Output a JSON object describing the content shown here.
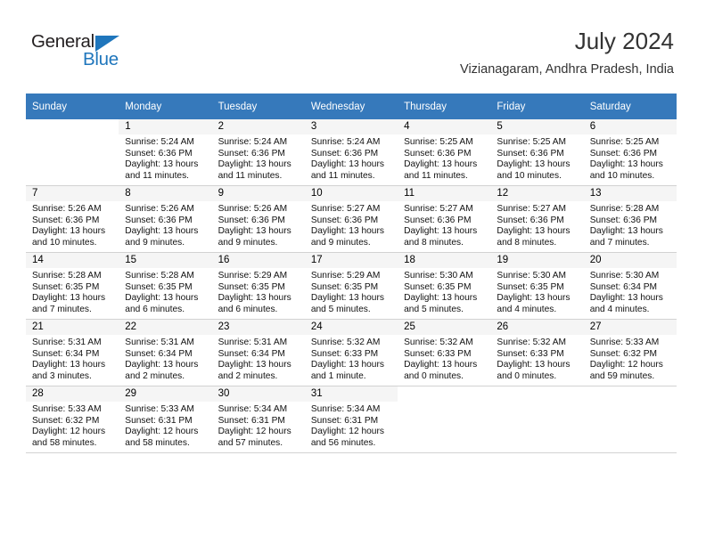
{
  "brand": {
    "name_part1": "General",
    "name_part2": "Blue",
    "colors": {
      "blue": "#1f76bc",
      "dark": "#231f20"
    }
  },
  "header": {
    "title": "July 2024",
    "subtitle": "Vizianagaram, Andhra Pradesh, India"
  },
  "calendar": {
    "header_bg": "#3679bb",
    "weekday_headers": [
      "Sunday",
      "Monday",
      "Tuesday",
      "Wednesday",
      "Thursday",
      "Friday",
      "Saturday"
    ],
    "labels": {
      "sunrise_prefix": "Sunrise:",
      "sunset_prefix": "Sunset:",
      "daylight_prefix": "Daylight:"
    },
    "weeks": [
      [
        {
          "day": "",
          "sunrise": "",
          "sunset": "",
          "daylight_line1": "",
          "daylight_line2": ""
        },
        {
          "day": "1",
          "sunrise": "Sunrise: 5:24 AM",
          "sunset": "Sunset: 6:36 PM",
          "daylight_line1": "Daylight: 13 hours",
          "daylight_line2": "and 11 minutes."
        },
        {
          "day": "2",
          "sunrise": "Sunrise: 5:24 AM",
          "sunset": "Sunset: 6:36 PM",
          "daylight_line1": "Daylight: 13 hours",
          "daylight_line2": "and 11 minutes."
        },
        {
          "day": "3",
          "sunrise": "Sunrise: 5:24 AM",
          "sunset": "Sunset: 6:36 PM",
          "daylight_line1": "Daylight: 13 hours",
          "daylight_line2": "and 11 minutes."
        },
        {
          "day": "4",
          "sunrise": "Sunrise: 5:25 AM",
          "sunset": "Sunset: 6:36 PM",
          "daylight_line1": "Daylight: 13 hours",
          "daylight_line2": "and 11 minutes."
        },
        {
          "day": "5",
          "sunrise": "Sunrise: 5:25 AM",
          "sunset": "Sunset: 6:36 PM",
          "daylight_line1": "Daylight: 13 hours",
          "daylight_line2": "and 10 minutes."
        },
        {
          "day": "6",
          "sunrise": "Sunrise: 5:25 AM",
          "sunset": "Sunset: 6:36 PM",
          "daylight_line1": "Daylight: 13 hours",
          "daylight_line2": "and 10 minutes."
        }
      ],
      [
        {
          "day": "7",
          "sunrise": "Sunrise: 5:26 AM",
          "sunset": "Sunset: 6:36 PM",
          "daylight_line1": "Daylight: 13 hours",
          "daylight_line2": "and 10 minutes."
        },
        {
          "day": "8",
          "sunrise": "Sunrise: 5:26 AM",
          "sunset": "Sunset: 6:36 PM",
          "daylight_line1": "Daylight: 13 hours",
          "daylight_line2": "and 9 minutes."
        },
        {
          "day": "9",
          "sunrise": "Sunrise: 5:26 AM",
          "sunset": "Sunset: 6:36 PM",
          "daylight_line1": "Daylight: 13 hours",
          "daylight_line2": "and 9 minutes."
        },
        {
          "day": "10",
          "sunrise": "Sunrise: 5:27 AM",
          "sunset": "Sunset: 6:36 PM",
          "daylight_line1": "Daylight: 13 hours",
          "daylight_line2": "and 9 minutes."
        },
        {
          "day": "11",
          "sunrise": "Sunrise: 5:27 AM",
          "sunset": "Sunset: 6:36 PM",
          "daylight_line1": "Daylight: 13 hours",
          "daylight_line2": "and 8 minutes."
        },
        {
          "day": "12",
          "sunrise": "Sunrise: 5:27 AM",
          "sunset": "Sunset: 6:36 PM",
          "daylight_line1": "Daylight: 13 hours",
          "daylight_line2": "and 8 minutes."
        },
        {
          "day": "13",
          "sunrise": "Sunrise: 5:28 AM",
          "sunset": "Sunset: 6:36 PM",
          "daylight_line1": "Daylight: 13 hours",
          "daylight_line2": "and 7 minutes."
        }
      ],
      [
        {
          "day": "14",
          "sunrise": "Sunrise: 5:28 AM",
          "sunset": "Sunset: 6:35 PM",
          "daylight_line1": "Daylight: 13 hours",
          "daylight_line2": "and 7 minutes."
        },
        {
          "day": "15",
          "sunrise": "Sunrise: 5:28 AM",
          "sunset": "Sunset: 6:35 PM",
          "daylight_line1": "Daylight: 13 hours",
          "daylight_line2": "and 6 minutes."
        },
        {
          "day": "16",
          "sunrise": "Sunrise: 5:29 AM",
          "sunset": "Sunset: 6:35 PM",
          "daylight_line1": "Daylight: 13 hours",
          "daylight_line2": "and 6 minutes."
        },
        {
          "day": "17",
          "sunrise": "Sunrise: 5:29 AM",
          "sunset": "Sunset: 6:35 PM",
          "daylight_line1": "Daylight: 13 hours",
          "daylight_line2": "and 5 minutes."
        },
        {
          "day": "18",
          "sunrise": "Sunrise: 5:30 AM",
          "sunset": "Sunset: 6:35 PM",
          "daylight_line1": "Daylight: 13 hours",
          "daylight_line2": "and 5 minutes."
        },
        {
          "day": "19",
          "sunrise": "Sunrise: 5:30 AM",
          "sunset": "Sunset: 6:35 PM",
          "daylight_line1": "Daylight: 13 hours",
          "daylight_line2": "and 4 minutes."
        },
        {
          "day": "20",
          "sunrise": "Sunrise: 5:30 AM",
          "sunset": "Sunset: 6:34 PM",
          "daylight_line1": "Daylight: 13 hours",
          "daylight_line2": "and 4 minutes."
        }
      ],
      [
        {
          "day": "21",
          "sunrise": "Sunrise: 5:31 AM",
          "sunset": "Sunset: 6:34 PM",
          "daylight_line1": "Daylight: 13 hours",
          "daylight_line2": "and 3 minutes."
        },
        {
          "day": "22",
          "sunrise": "Sunrise: 5:31 AM",
          "sunset": "Sunset: 6:34 PM",
          "daylight_line1": "Daylight: 13 hours",
          "daylight_line2": "and 2 minutes."
        },
        {
          "day": "23",
          "sunrise": "Sunrise: 5:31 AM",
          "sunset": "Sunset: 6:34 PM",
          "daylight_line1": "Daylight: 13 hours",
          "daylight_line2": "and 2 minutes."
        },
        {
          "day": "24",
          "sunrise": "Sunrise: 5:32 AM",
          "sunset": "Sunset: 6:33 PM",
          "daylight_line1": "Daylight: 13 hours",
          "daylight_line2": "and 1 minute."
        },
        {
          "day": "25",
          "sunrise": "Sunrise: 5:32 AM",
          "sunset": "Sunset: 6:33 PM",
          "daylight_line1": "Daylight: 13 hours",
          "daylight_line2": "and 0 minutes."
        },
        {
          "day": "26",
          "sunrise": "Sunrise: 5:32 AM",
          "sunset": "Sunset: 6:33 PM",
          "daylight_line1": "Daylight: 13 hours",
          "daylight_line2": "and 0 minutes."
        },
        {
          "day": "27",
          "sunrise": "Sunrise: 5:33 AM",
          "sunset": "Sunset: 6:32 PM",
          "daylight_line1": "Daylight: 12 hours",
          "daylight_line2": "and 59 minutes."
        }
      ],
      [
        {
          "day": "28",
          "sunrise": "Sunrise: 5:33 AM",
          "sunset": "Sunset: 6:32 PM",
          "daylight_line1": "Daylight: 12 hours",
          "daylight_line2": "and 58 minutes."
        },
        {
          "day": "29",
          "sunrise": "Sunrise: 5:33 AM",
          "sunset": "Sunset: 6:31 PM",
          "daylight_line1": "Daylight: 12 hours",
          "daylight_line2": "and 58 minutes."
        },
        {
          "day": "30",
          "sunrise": "Sunrise: 5:34 AM",
          "sunset": "Sunset: 6:31 PM",
          "daylight_line1": "Daylight: 12 hours",
          "daylight_line2": "and 57 minutes."
        },
        {
          "day": "31",
          "sunrise": "Sunrise: 5:34 AM",
          "sunset": "Sunset: 6:31 PM",
          "daylight_line1": "Daylight: 12 hours",
          "daylight_line2": "and 56 minutes."
        },
        {
          "day": "",
          "sunrise": "",
          "sunset": "",
          "daylight_line1": "",
          "daylight_line2": ""
        },
        {
          "day": "",
          "sunrise": "",
          "sunset": "",
          "daylight_line1": "",
          "daylight_line2": ""
        },
        {
          "day": "",
          "sunrise": "",
          "sunset": "",
          "daylight_line1": "",
          "daylight_line2": ""
        }
      ]
    ]
  }
}
